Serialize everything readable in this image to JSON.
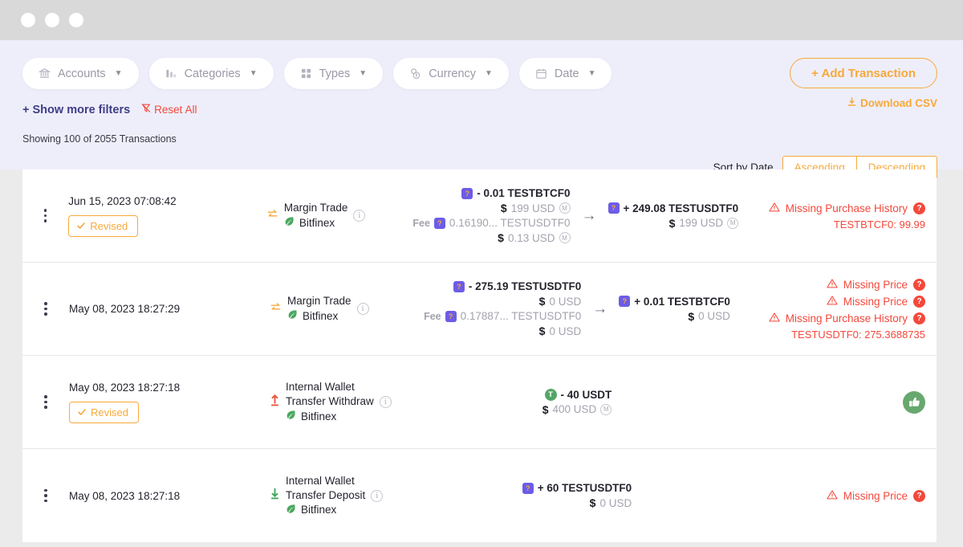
{
  "window": {
    "dots": 3
  },
  "filters": {
    "chips": [
      {
        "label": "Accounts",
        "icon": "bank-icon"
      },
      {
        "label": "Categories",
        "icon": "categories-icon"
      },
      {
        "label": "Types",
        "icon": "grid-icon"
      },
      {
        "label": "Currency",
        "icon": "coins-icon"
      },
      {
        "label": "Date",
        "icon": "calendar-icon"
      }
    ],
    "show_more": "+ Show more filters",
    "reset_all": "Reset All",
    "showing": "Showing 100 of 2055 Transactions"
  },
  "actions": {
    "add_transaction": "+ Add Transaction",
    "download_csv": "Download CSV",
    "sort_label": "Sort by Date",
    "sort_options": [
      "Ascending",
      "Descending"
    ]
  },
  "colors": {
    "accent_orange": "#f7a93b",
    "error_red": "#f4483b",
    "brand_purple": "#3f3d87",
    "panel_bg": "#eeeefb",
    "success_green": "#68a86f"
  },
  "transactions": [
    {
      "date": "Jun 15, 2023 07:08:42",
      "revised": "Revised",
      "type": "Margin Trade",
      "type_line2": "",
      "type_icon": "margin-trade-icon",
      "venue": "Bitfinex",
      "out": {
        "sign": "-",
        "amount": "0.01",
        "asset": "TESTBTCF0",
        "usd": "199 USD",
        "fee_label": "Fee",
        "fee_amount": "0.16190...",
        "fee_asset": "TESTUSDTF0",
        "fee_usd": "0.13 USD"
      },
      "in": {
        "sign": "+",
        "amount": "249.08",
        "asset": "TESTUSDTF0",
        "usd": "199 USD"
      },
      "warnings": [
        "Missing Purchase History"
      ],
      "sub_warning": "TESTBTCF0: 99.99",
      "ok": false
    },
    {
      "date": "May 08, 2023 18:27:29",
      "revised": "",
      "type": "Margin Trade",
      "type_line2": "",
      "type_icon": "margin-trade-icon",
      "venue": "Bitfinex",
      "out": {
        "sign": "-",
        "amount": "275.19",
        "asset": "TESTUSDTF0",
        "usd": "0 USD",
        "fee_label": "Fee",
        "fee_amount": "0.17887...",
        "fee_asset": "TESTUSDTF0",
        "fee_usd": "0 USD"
      },
      "in": {
        "sign": "+",
        "amount": "0.01",
        "asset": "TESTBTCF0",
        "usd": "0 USD"
      },
      "warnings": [
        "Missing Price",
        "Missing Price",
        "Missing Purchase History"
      ],
      "sub_warning": "TESTUSDTF0: 275.3688735",
      "ok": false
    },
    {
      "date": "May 08, 2023 18:27:18",
      "revised": "Revised",
      "type": "Internal Wallet",
      "type_line2": "Transfer Withdraw",
      "type_icon": "withdraw-arrow-icon",
      "venue": "Bitfinex",
      "out": {
        "sign": "-",
        "amount": "40",
        "asset": "USDT",
        "usd": "400 USD",
        "fee_label": "",
        "fee_amount": "",
        "fee_asset": "",
        "fee_usd": ""
      },
      "in": null,
      "warnings": [],
      "sub_warning": "",
      "ok": true
    },
    {
      "date": "May 08, 2023 18:27:18",
      "revised": "",
      "type": "Internal Wallet",
      "type_line2": "Transfer Deposit",
      "type_icon": "deposit-arrow-icon",
      "venue": "Bitfinex",
      "out": {
        "sign": "+",
        "amount": "60",
        "asset": "TESTUSDTF0",
        "usd": "0 USD",
        "fee_label": "",
        "fee_amount": "",
        "fee_asset": "",
        "fee_usd": ""
      },
      "in": null,
      "warnings": [
        "Missing Price"
      ],
      "sub_warning": "",
      "ok": false
    }
  ]
}
